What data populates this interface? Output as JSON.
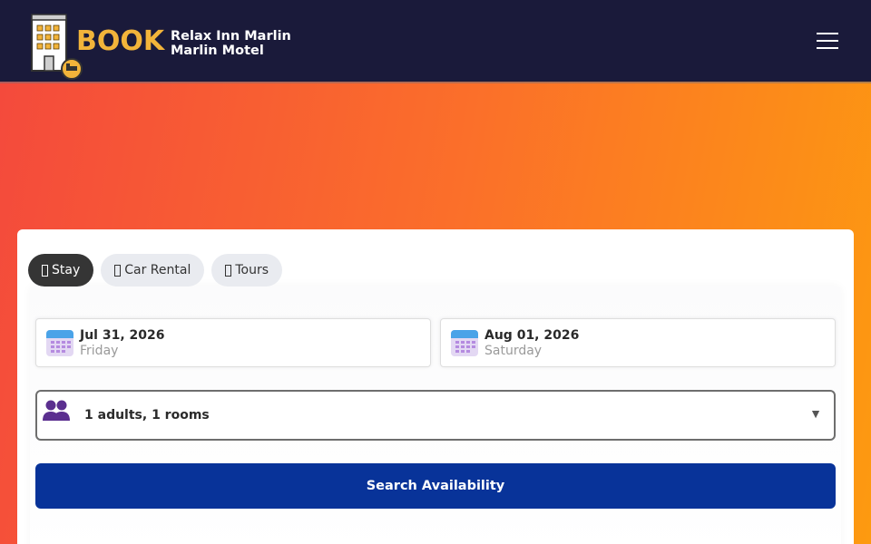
{
  "header": {
    "brand": "BOOK",
    "hotel_line1": "Relax Inn Marlin",
    "hotel_line2": "Marlin Motel"
  },
  "tabs": [
    {
      "label": "Stay",
      "active": true
    },
    {
      "label": "Car Rental",
      "active": false
    },
    {
      "label": "Tours",
      "active": false
    }
  ],
  "checkin": {
    "date": "Jul 31, 2026",
    "day": "Friday"
  },
  "checkout": {
    "date": "Aug 01, 2026",
    "day": "Saturday"
  },
  "guests": {
    "summary": "1 adults, 1 rooms",
    "caret": "▼"
  },
  "search": {
    "label": "Search Availability"
  },
  "colors": {
    "header_bg": "#1a1a3a",
    "brand_accent": "#f2b43a",
    "hero_gradient_start": "#f44a3c",
    "hero_gradient_end": "#fd9a10",
    "search_button": "#083399",
    "active_tab": "#353535"
  },
  "icons": {
    "logo": "hotel-building-icon",
    "menu": "hamburger-menu-icon",
    "calendar": "calendar-icon",
    "guests": "people-icon",
    "tab_glyph": "missing-glyph-icon"
  }
}
